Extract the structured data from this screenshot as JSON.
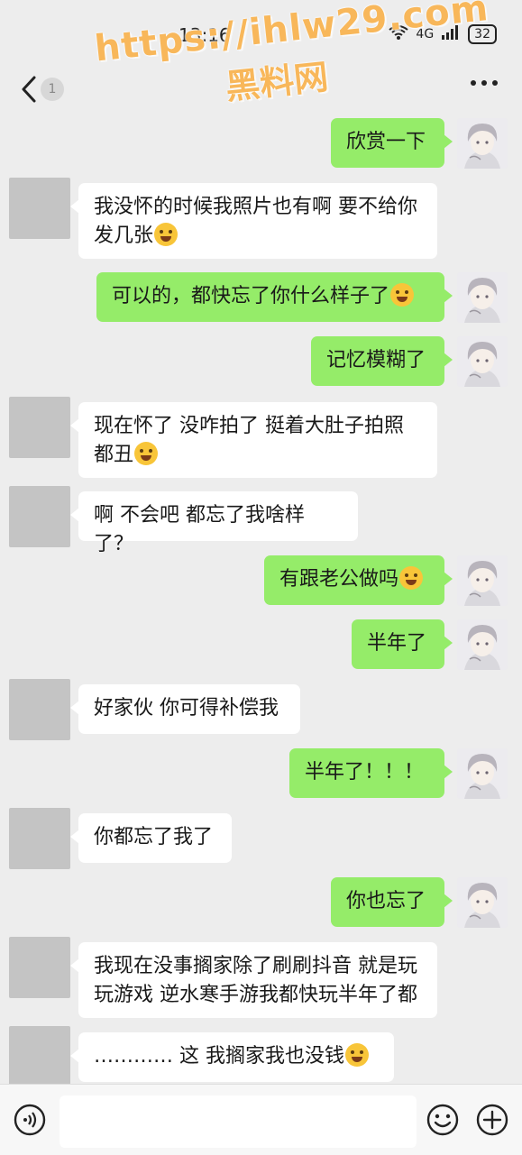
{
  "status_bar": {
    "time": "13:16",
    "network": "4G",
    "battery": "32"
  },
  "watermark": {
    "line1": "https://ihlw29.com",
    "line2": "黑料网"
  },
  "header": {
    "back_icon": "chevron-left-icon",
    "unread_count": "1",
    "more_icon": "ellipsis-icon"
  },
  "messages": [
    {
      "side": "out",
      "text": "欣赏一下",
      "emoji": false
    },
    {
      "side": "in",
      "text": "我没怀的时候我照片也有啊 要不给你发几张",
      "emoji": true
    },
    {
      "side": "out",
      "text": "可以的，都快忘了你什么样子了",
      "emoji": true
    },
    {
      "side": "out",
      "text": "记忆模糊了",
      "emoji": false
    },
    {
      "side": "in",
      "text": "现在怀了 没咋拍了 挺着大肚子拍照都丑",
      "emoji": true
    },
    {
      "side": "in",
      "text": "啊 不会吧 都忘了我啥样了？",
      "emoji": false
    },
    {
      "side": "out",
      "text": "有跟老公做吗",
      "emoji": true
    },
    {
      "side": "out",
      "text": "半年了",
      "emoji": false
    },
    {
      "side": "in",
      "text": "好家伙 你可得补偿我",
      "emoji": false
    },
    {
      "side": "out",
      "text": "半年了！！！",
      "emoji": false
    },
    {
      "side": "in",
      "text": "你都忘了我了",
      "emoji": false
    },
    {
      "side": "out",
      "text": "你也忘了",
      "emoji": false
    },
    {
      "side": "in",
      "text": "我现在没事搁家除了刷刷抖音 就是玩玩游戏 逆水寒手游我都快玩半年了都",
      "emoji": false
    },
    {
      "side": "in",
      "text": "………… 这 我搁家我也没钱",
      "emoji": true
    }
  ],
  "input_bar": {
    "voice_icon": "voice-icon",
    "emoji_icon": "emoji-icon",
    "plus_icon": "plus-icon",
    "text_value": ""
  },
  "colors": {
    "background": "#ededed",
    "outgoing_bubble": "#95ec69",
    "incoming_bubble": "#ffffff",
    "watermark": "#f8b75a"
  }
}
